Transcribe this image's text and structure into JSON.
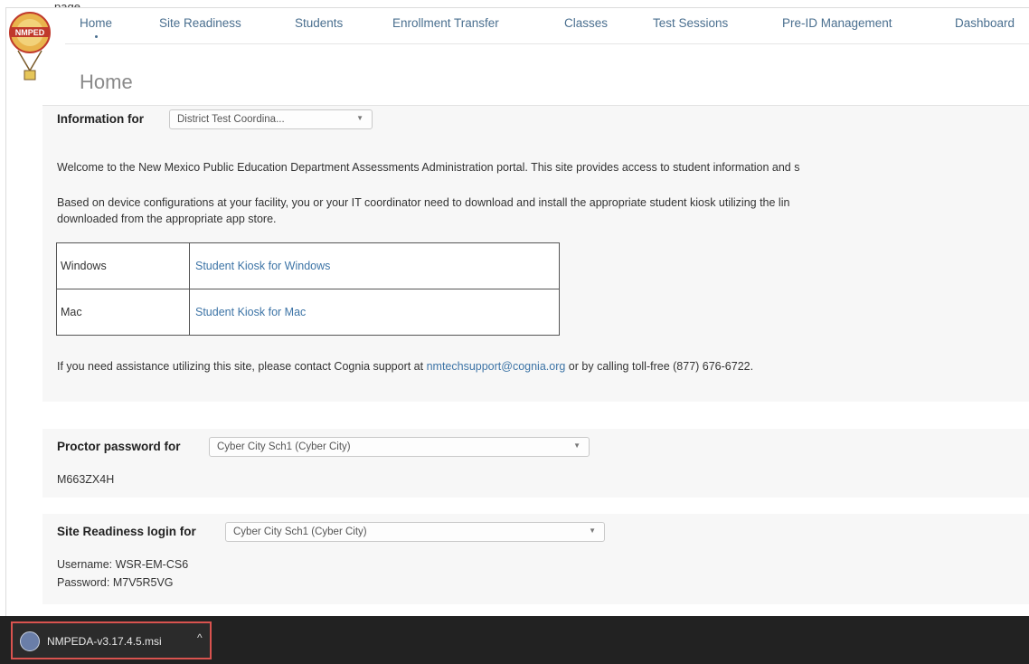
{
  "top_clip": "page",
  "nav": {
    "items": [
      "Home",
      "Site Readiness",
      "Students",
      "Enrollment Transfer",
      "Classes",
      "Test Sessions",
      "Pre-ID Management",
      "Dashboard"
    ]
  },
  "page_title": "Home",
  "info_section": {
    "label": "Information for",
    "selected_role": "District Test Coordina...",
    "welcome_text": "Welcome to the  New Mexico Public Education Department Assessments Administration portal. This site provides access to student information and s",
    "device_text_line1": "Based on device configurations at your facility, you or your IT coordinator need to download and install the appropriate student kiosk utilizing the lin",
    "device_text_line2": "downloaded from the appropriate app store.",
    "kiosk_table": [
      {
        "os": "Windows",
        "link": "Student Kiosk for Windows"
      },
      {
        "os": "Mac",
        "link": "Student Kiosk for Mac"
      }
    ],
    "support_prefix": "If you need assistance utilizing this site, please contact Cognia support at ",
    "support_email": "nmtechsupport@cognia.org",
    "support_suffix": " or by calling toll-free (877) 676-6722."
  },
  "proctor": {
    "label": "Proctor password for",
    "selected_school": "Cyber City Sch1 (Cyber City)",
    "password": "M663ZX4H"
  },
  "site_readiness": {
    "label": "Site Readiness login for",
    "selected_school": "Cyber City Sch1 (Cyber City)",
    "username_line": "Username: WSR-EM-CS6",
    "password_line": "Password: M7V5R5VG"
  },
  "download_bar": {
    "filename": "NMPEDA-v3.17.4.5.msi",
    "icon": "installer-icon"
  },
  "colors": {
    "nav_link": "#4a6f8f",
    "link": "#3d74a6",
    "download_highlight": "#d9534f",
    "download_bar": "#222222"
  }
}
